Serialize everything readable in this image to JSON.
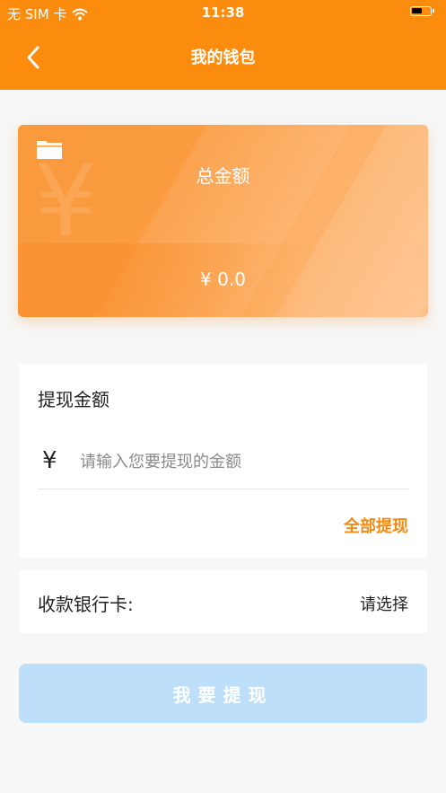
{
  "status_bar": {
    "carrier": "无 SIM 卡",
    "time": "11:38",
    "icons": [
      "wifi-icon",
      "battery-icon"
    ]
  },
  "nav": {
    "title": "我的钱包",
    "back_icon": "chevron-left-icon"
  },
  "card": {
    "icon": "wallet-icon",
    "watermark": "¥",
    "total_label": "总金额",
    "total_value": "¥ 0.0"
  },
  "withdraw": {
    "heading": "提现金额",
    "currency_symbol": "¥",
    "input_value": "",
    "input_placeholder": "请输入您要提现的金额",
    "withdraw_all_label": "全部提现"
  },
  "bank": {
    "label": "收款银行卡:",
    "value": "请选择"
  },
  "submit": {
    "label": "我要提现"
  },
  "colors": {
    "accent": "#fb8c0e",
    "link": "#f38a12",
    "submit_disabled": "#bddff9",
    "background": "#f7f7f7"
  }
}
